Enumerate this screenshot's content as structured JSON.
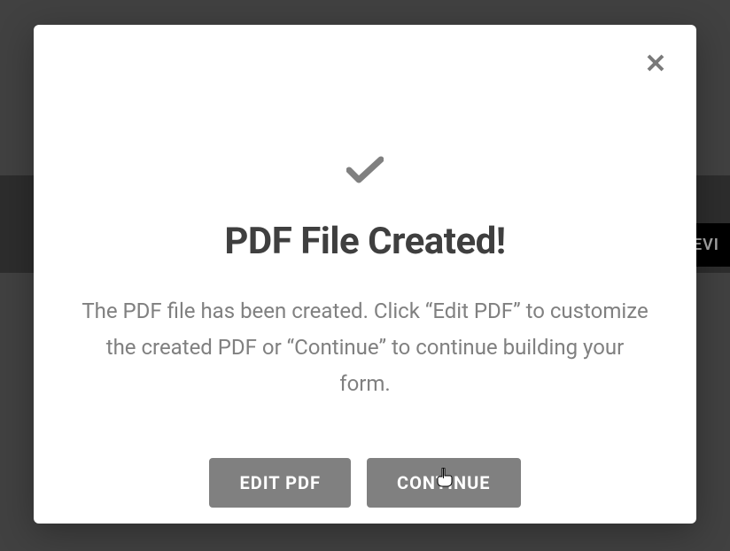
{
  "background": {
    "partial_button_text": "EVI"
  },
  "modal": {
    "title": "PDF File Created!",
    "description": "The PDF file has been created. Click “Edit PDF” to customize the created PDF or “Continue” to continue building your form.",
    "buttons": {
      "edit_pdf": "EDIT PDF",
      "continue": "CONTINUE"
    }
  }
}
